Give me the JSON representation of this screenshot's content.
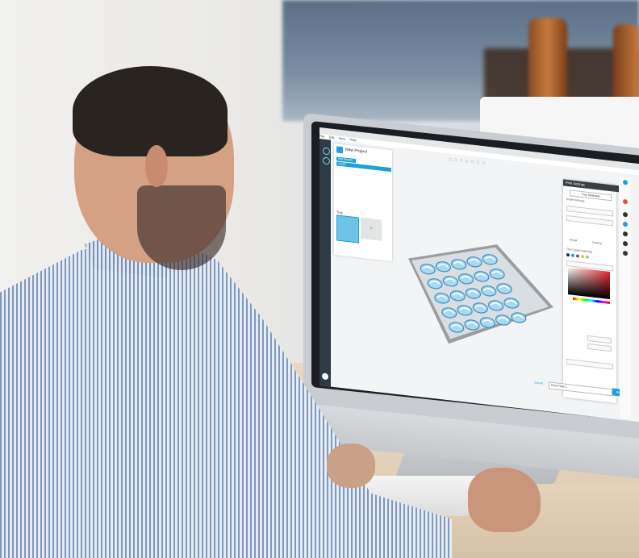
{
  "scene": {
    "subject": "man-at-desktop-monitor"
  },
  "app": {
    "menu": [
      "File",
      "Edit",
      "View",
      "Help"
    ],
    "project_title": "New Project",
    "project_tab": "Add Models",
    "project_item": "model",
    "tray_label": "Tray",
    "tray_add_symbol": "+",
    "settings_title": "Print Settings",
    "settings_button": "Tray Materials",
    "settings_section": "Model Settings",
    "mode_labels": [
      "Model",
      "Coating"
    ],
    "color_section": "Top Coated Materials",
    "print_button": "Print",
    "cancel_label": "Cancel",
    "printer_value": "Print Plate 1"
  },
  "colors": {
    "accent": "#1ea0d9",
    "swatches": [
      "#1d2a6b",
      "#1ea0d9",
      "#8a3ca6",
      "#f0c419",
      "#b0b4b8"
    ]
  }
}
